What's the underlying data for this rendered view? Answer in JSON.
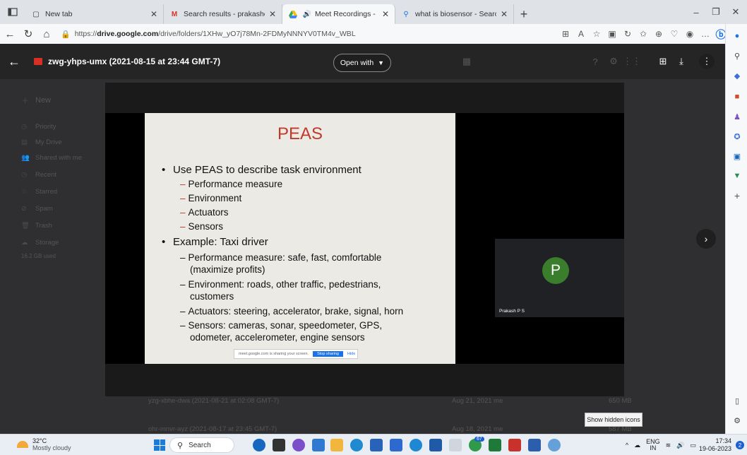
{
  "browser": {
    "tabs": [
      {
        "title": "New tab",
        "icon": "new-tab-icon"
      },
      {
        "title": "Search results - prakashcse@vce",
        "icon": "gmail-icon"
      },
      {
        "title": "Meet Recordings - Google [",
        "icon": "google-drive-icon"
      },
      {
        "title": "what is biosensor - Search",
        "icon": "search-icon"
      }
    ],
    "new_tab": "+",
    "window_controls": {
      "minimize": "–",
      "restore": "❐",
      "close": "✕"
    },
    "url": "https://drive.google.com/drive/folders/1XHw_yO7j78Mn-2FDMyNNNYV0TM4v_WBL",
    "url_host_bold": "drive.google.com"
  },
  "viewer": {
    "file_name": "zwg-yhps-umx (2021-08-15 at 23:44 GMT-7)",
    "open_with": "Open with"
  },
  "drive_sidebar": {
    "new_label": "New",
    "items": [
      "Priority",
      "My Drive",
      "Shared with me",
      "Recent",
      "Starred",
      "Spam",
      "Trash",
      "Storage"
    ],
    "storage_text": "16.2 GB used"
  },
  "slide": {
    "title": "PEAS",
    "bullet1": "Use PEAS to describe task environment",
    "sub1": [
      "Performance measure",
      "Environment",
      "Actuators",
      "Sensors"
    ],
    "bullet2": "Example: Taxi driver",
    "sub2": [
      {
        "lines": [
          "Performance measure:  safe, fast, comfortable",
          "(maximize profits)"
        ]
      },
      {
        "lines": [
          "Environment:  roads, other traffic, pedestrians,",
          "customers"
        ]
      },
      {
        "lines": [
          "Actuators:  steering, accelerator, brake, signal, horn"
        ]
      },
      {
        "lines": [
          "Sensors: cameras, sonar, speedometer, GPS,",
          "odometer, accelerometer, engine sensors"
        ]
      }
    ]
  },
  "share_banner": {
    "text": "meet.google.com is sharing your screen.",
    "stop": "Stop sharing",
    "hide": "Hide"
  },
  "participant": {
    "initial": "P",
    "name": "Prakash P S"
  },
  "background_rows": [
    {
      "name": "yzg-xbhe-dwa (2021-08-21 at 02:08 GMT-7)",
      "date": "Aug 21, 2021 me",
      "size": "650 MB"
    },
    {
      "name": "ohr-mnvr-ayz (2021-08-17 at 23:45 GMT-7)",
      "date": "Aug 18, 2021 me",
      "size": "587 MB"
    }
  ],
  "tooltip": "Show hidden icons",
  "taskbar": {
    "temp": "32°C",
    "condition": "Mostly cloudy",
    "search": "Search",
    "lang": "ENG",
    "region": "IN",
    "time": "17:34",
    "date": "19-06-2023",
    "notifications": "2",
    "badge_count": "67"
  }
}
